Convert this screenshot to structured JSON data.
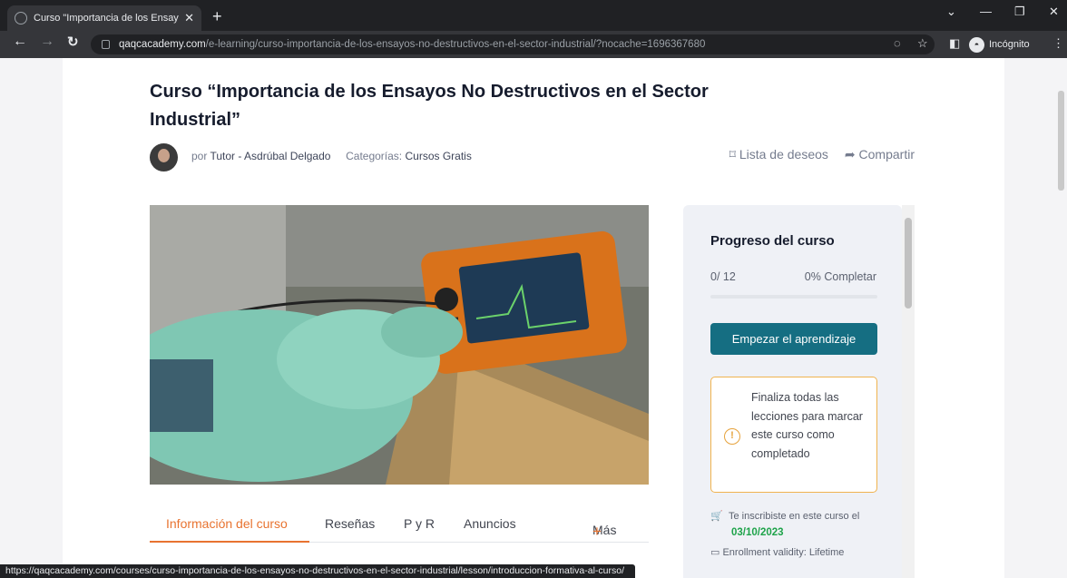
{
  "browser": {
    "tab_title": "Curso \"Importancia de los Ensay",
    "new_tab": "+",
    "url_host": "qaqcacademy.com",
    "url_path": "/e-learning/curso-importancia-de-los-ensayos-no-destructivos-en-el-sector-industrial/?nocache=1696367680",
    "incognito_label": "Incógnito"
  },
  "course": {
    "title": "Curso “Importancia de los Ensayos No Destructivos en el Sector Industrial”",
    "by_prefix": "por",
    "author": "Tutor - Asdrúbal Delgado",
    "categories_label": "Categorías:",
    "category": "Cursos Gratis",
    "wishlist": "Lista de deseos",
    "share": "Compartir"
  },
  "tabs": {
    "info": "Información del curso",
    "reviews": "Reseñas",
    "qa": "P y R",
    "announcements": "Anuncios",
    "more": "Más"
  },
  "sidebar": {
    "progress_title": "Progreso del curso",
    "progress_count": "0/ 12",
    "progress_percent": "0% Completar",
    "progress_fraction": 0,
    "start_button": "Empezar el aprendizaje",
    "notice": "Finaliza todas las lecciones para marcar este curso como completado",
    "enrolled_text": "Te inscribiste en este curso el",
    "enrolled_date": "03/10/2023",
    "validity": "Enrollment validity: Lifetime"
  },
  "status_url": "https://qaqcacademy.com/courses/curso-importancia-de-los-ensayos-no-destructivos-en-el-sector-industrial/lesson/introduccion-formativa-al-curso/",
  "colors": {
    "accent_orange": "#e87330",
    "primary_teal": "#156e82",
    "success_green": "#1ea34a",
    "notice_border": "#f0b34f"
  }
}
